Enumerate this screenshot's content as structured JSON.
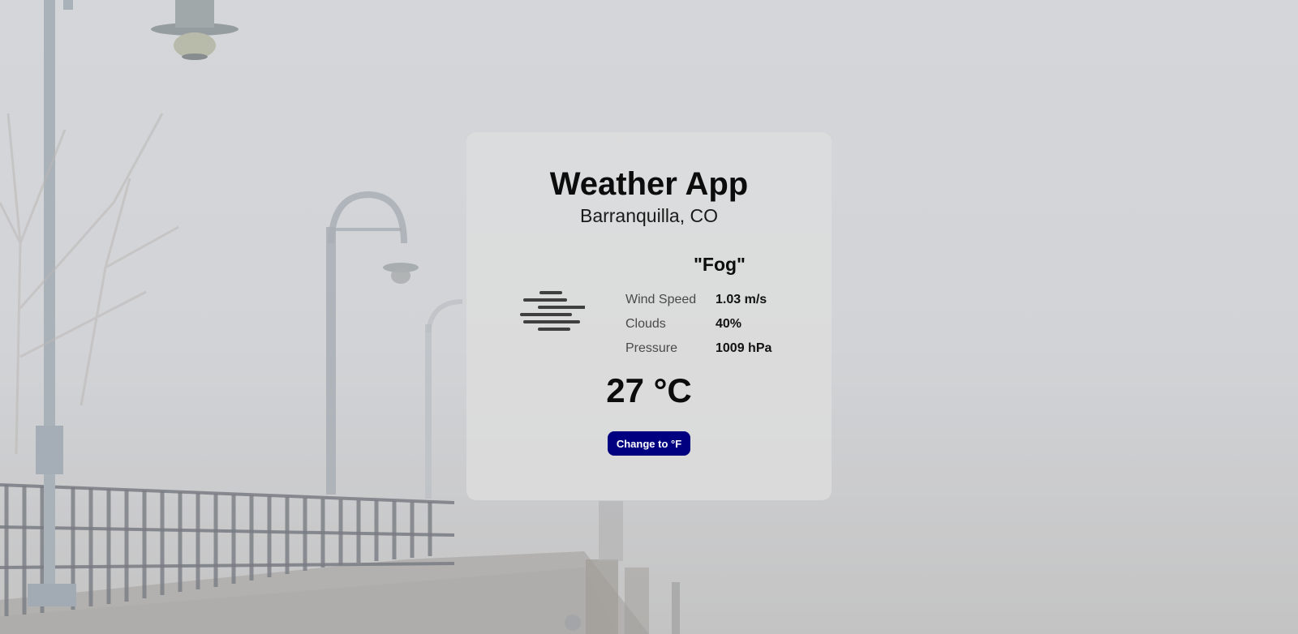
{
  "app": {
    "title": "Weather App",
    "location": "Barranquilla, CO"
  },
  "weather": {
    "condition": "\"Fog\"",
    "icon": "fog-icon",
    "temperature": "27 °C",
    "details": [
      {
        "label": "Wind Speed",
        "value": "1.03 m/s"
      },
      {
        "label": "Clouds",
        "value": "40%"
      },
      {
        "label": "Pressure",
        "value": "1009 hPa"
      }
    ]
  },
  "controls": {
    "unit_toggle_label": "Change to °F"
  },
  "colors": {
    "button_bg": "#000080",
    "button_text": "#ffffff",
    "card_bg": "#dedede",
    "text_primary": "#0c0c0c",
    "text_secondary": "#4a4a4a"
  }
}
